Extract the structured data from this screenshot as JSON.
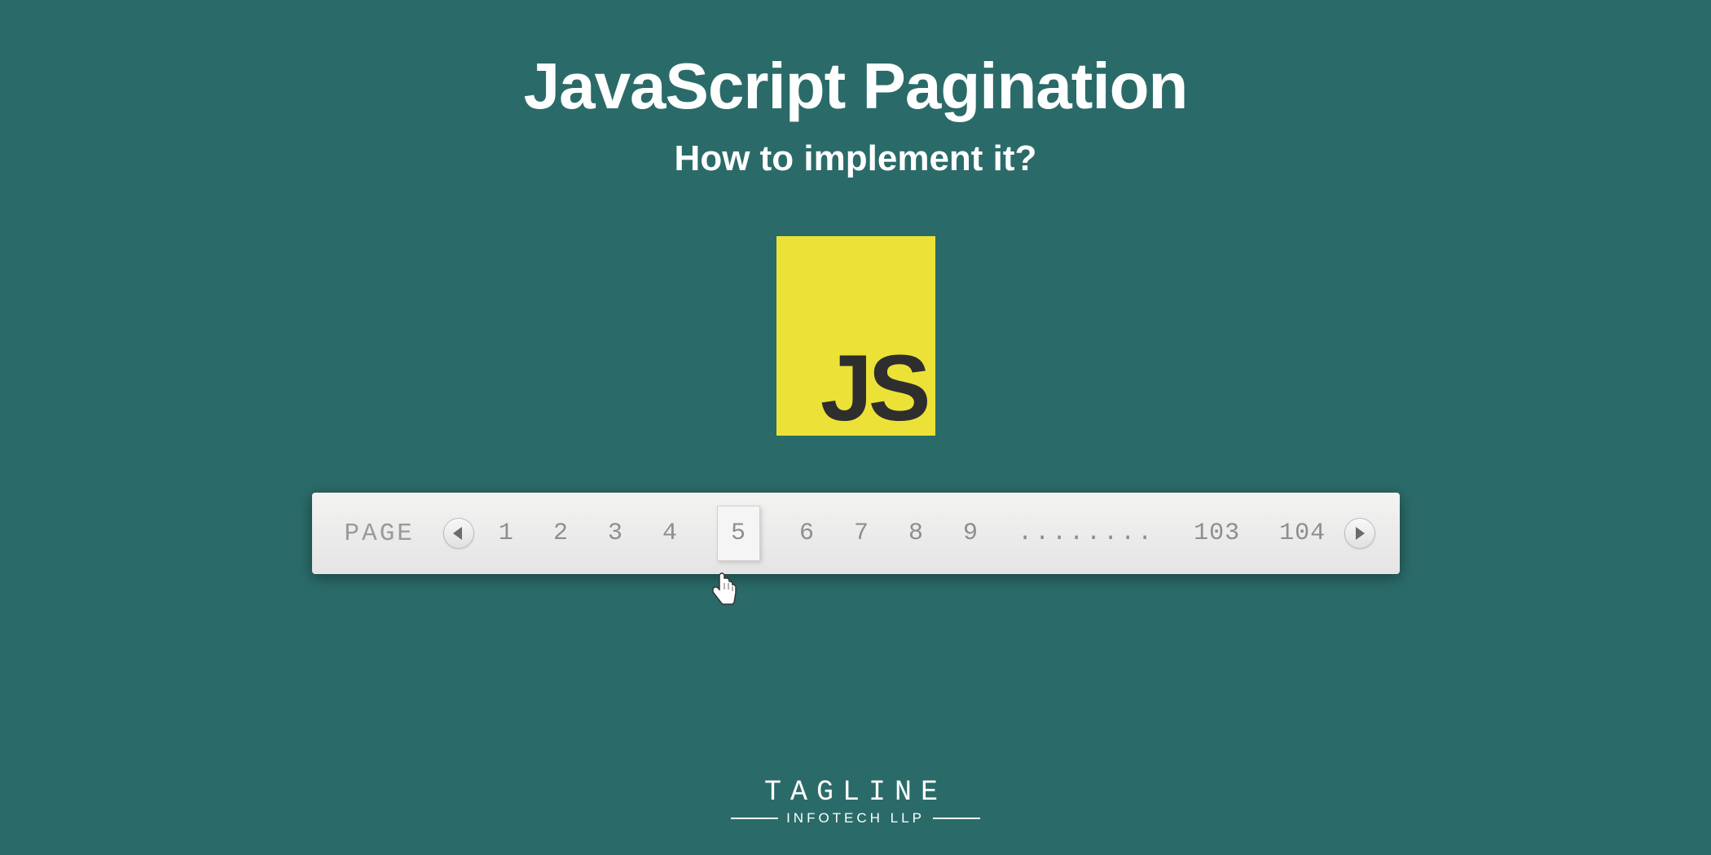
{
  "header": {
    "title": "JavaScript Pagination",
    "subtitle": "How to implement it?"
  },
  "logo": {
    "text": "JS"
  },
  "pagination": {
    "label": "PAGE",
    "pages": [
      "1",
      "2",
      "3",
      "4",
      "5",
      "6",
      "7",
      "8",
      "9"
    ],
    "current_page": "5",
    "ellipsis": "........",
    "last_pages": [
      "103",
      "104"
    ]
  },
  "footer": {
    "brand": "TAGLINE",
    "tagline": "INFOTECH LLP"
  }
}
